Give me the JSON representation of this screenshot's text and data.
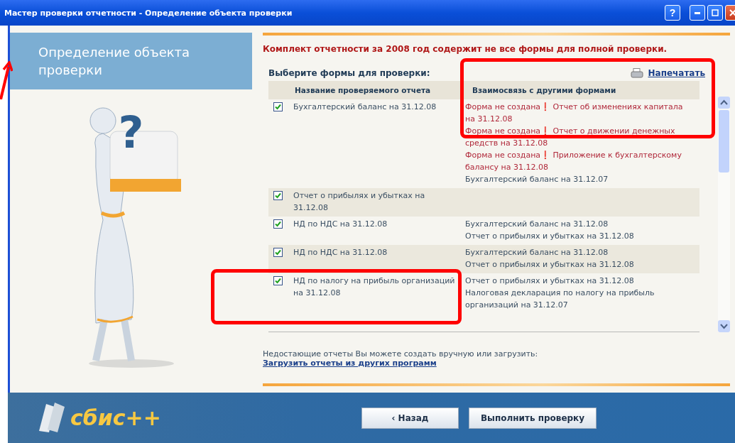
{
  "window": {
    "title": "Мастер проверки отчетности - Определение объекта проверки",
    "buttons": [
      "?"
    ]
  },
  "sidebar": {
    "step_title": "Определение объекта проверки",
    "illustration_mark": "?"
  },
  "warning": "Комплект отчетности за 2008 год содержит не все формы для полной проверки.",
  "select_label": "Выберите формы для проверки:",
  "print_link": "Напечатать",
  "table": {
    "columns": [
      "Название проверяемого отчета",
      "Взаимосвязь с другими формами"
    ],
    "rows": [
      {
        "checked": true,
        "name": "Бухгалтерский баланс на 31.12.08",
        "relations": [
          {
            "kind": "missing",
            "text": "Форма не создана❗ Отчет об изменениях капитала на 31.12.08"
          },
          {
            "kind": "missing",
            "text": "Форма не создана❗ Отчет о движении денежных средств на 31.12.08"
          },
          {
            "kind": "missing",
            "text": "Форма не создана❗ Приложение к бухгалтерскому балансу на 31.12.08"
          },
          {
            "kind": "ok",
            "text": "Бухгалтерский баланс на 31.12.07"
          }
        ]
      },
      {
        "checked": true,
        "name": "Отчет о прибылях и убытках на 31.12.08",
        "relations": []
      },
      {
        "checked": true,
        "name": "НД по НДС на 31.12.08",
        "relations": [
          {
            "kind": "ok",
            "text": "Бухгалтерский баланс на 31.12.08"
          },
          {
            "kind": "ok",
            "text": "Отчет о прибылях и убытках на 31.12.08"
          }
        ]
      },
      {
        "checked": true,
        "name": "НД по НДС на 31.12.08",
        "relations": [
          {
            "kind": "ok",
            "text": "Бухгалтерский баланс на 31.12.08"
          },
          {
            "kind": "ok",
            "text": "Отчет о прибылях и убытках на 31.12.08"
          }
        ]
      },
      {
        "checked": true,
        "name": "НД по налогу на прибыль организаций на 31.12.08",
        "relations": [
          {
            "kind": "ok",
            "text": "Отчет о прибылях и убытках на 31.12.08"
          },
          {
            "kind": "ok",
            "text": "Налоговая декларация по налогу на прибыль организаций на 31.12.07"
          }
        ]
      }
    ]
  },
  "hint": "Недостающие отчеты Вы можете создать вручную или загрузить:",
  "import_link": "Загрузить отчеты из других программ",
  "footer": {
    "logo": "сбис++",
    "buttons": [
      "‹ Назад",
      "Выполнить проверку"
    ]
  }
}
